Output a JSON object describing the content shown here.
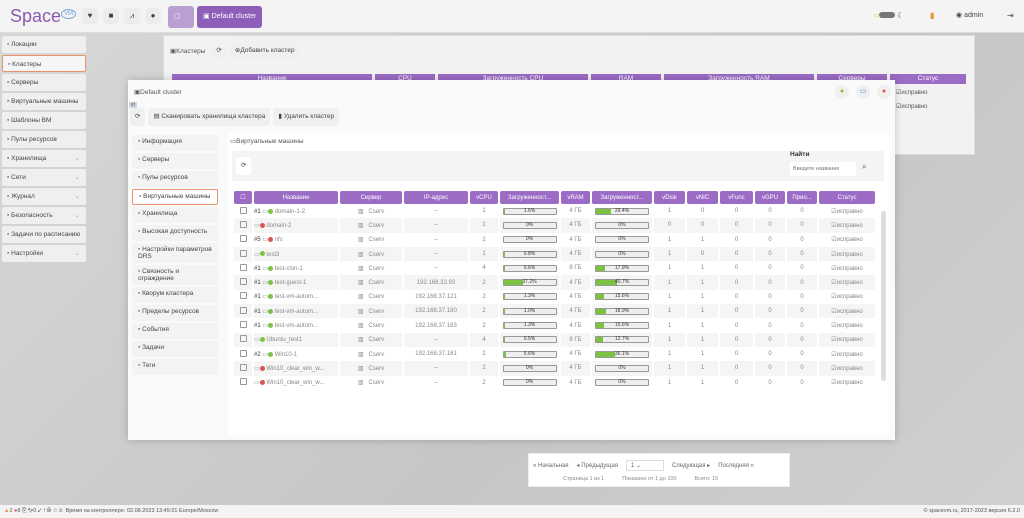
{
  "header": {
    "logo": "Space",
    "logo_badge": "VM",
    "tab_label": "Default cluster",
    "user": "admin",
    "icons": [
      "heart-icon",
      "folder-icon",
      "network-icon",
      "globe-icon"
    ]
  },
  "sidebar": {
    "items": [
      {
        "label": "Локации"
      },
      {
        "label": "Кластеры",
        "active": true
      },
      {
        "label": "Серверы"
      },
      {
        "label": "Виртуальные машины"
      },
      {
        "label": "Шаблоны ВМ"
      },
      {
        "label": "Пулы ресурсов"
      },
      {
        "label": "Хранилища",
        "chevron": true
      },
      {
        "label": "Сети",
        "chevron": true
      },
      {
        "label": "Журнал",
        "chevron": true
      },
      {
        "label": "Безопасность",
        "chevron": true
      },
      {
        "label": "Задачи по расписанию"
      },
      {
        "label": "Настройки",
        "chevron": true
      }
    ]
  },
  "bg_panel": {
    "title": "Кластеры",
    "add_label": "Добавить кластер",
    "columns": [
      "Название",
      "CPU",
      "Загруженность CPU",
      "RAM",
      "Загруженность RAM",
      "Серверы",
      "Статус"
    ],
    "status_values": [
      "исправно",
      "исправно"
    ]
  },
  "modal": {
    "title": "Default cluster",
    "id_badge": "id",
    "scan_label": "Сканировать хранилища кластера",
    "delete_label": "Удалить кластер",
    "nav": [
      {
        "label": "Информация"
      },
      {
        "label": "Серверы"
      },
      {
        "label": "Пулы ресурсов"
      },
      {
        "label": "Виртуальные машины",
        "active": true
      },
      {
        "label": "Хранилища"
      },
      {
        "label": "Высокая доступность"
      },
      {
        "label": "Настройки параметров DRS"
      },
      {
        "label": "Связность и ограждение"
      },
      {
        "label": "Кворум кластера"
      },
      {
        "label": "Пределы ресурсов"
      },
      {
        "label": "События"
      },
      {
        "label": "Задачи"
      },
      {
        "label": "Теги"
      }
    ],
    "section_title": "Виртуальные машины",
    "search_label": "Найти",
    "search_placeholder": "Введите название",
    "columns": [
      "Название",
      "Сервер",
      "IP-адрес",
      "vCPU",
      "Загруженност...",
      "vRAM",
      "Загруженност...",
      "vDisk",
      "vNIC",
      "vFunc",
      "vGPU",
      "Прио...",
      "Статус"
    ],
    "rows": [
      {
        "name": "domain-1-2",
        "tag": "#1",
        "on": true,
        "server": "Cserv",
        "ip": "–",
        "vcpu": "1",
        "cpu": 1.6,
        "cpu_label": "1.6%",
        "vram": "4 ГБ",
        "ram": 29.4,
        "ram_label": "29.4%",
        "vdisk": "1",
        "vnic": "0",
        "vfunc": "0",
        "vgpu": "0",
        "prio": "0",
        "status": "исправно"
      },
      {
        "name": "domain-2",
        "tag": "",
        "on": false,
        "server": "Cserv",
        "ip": "–",
        "vcpu": "1",
        "cpu": 0,
        "cpu_label": "0%",
        "vram": "4 ГБ",
        "ram": 0,
        "ram_label": "0%",
        "vdisk": "0",
        "vnic": "0",
        "vfunc": "0",
        "vgpu": "0",
        "prio": "0",
        "status": "исправно"
      },
      {
        "name": "nfs",
        "tag": "#5",
        "on": false,
        "server": "Cserv",
        "ip": "–",
        "vcpu": "2",
        "cpu": 0,
        "cpu_label": "0%",
        "vram": "4 ГБ",
        "ram": 0,
        "ram_label": "0%",
        "vdisk": "1",
        "vnic": "1",
        "vfunc": "0",
        "vgpu": "0",
        "prio": "0",
        "status": "исправно"
      },
      {
        "name": "test3",
        "tag": "",
        "on": true,
        "server": "Cserv",
        "ip": "–",
        "vcpu": "1",
        "cpu": 0.8,
        "cpu_label": "0.8%",
        "vram": "4 ГБ",
        "ram": 0,
        "ram_label": "0%",
        "vdisk": "1",
        "vnic": "0",
        "vfunc": "0",
        "vgpu": "0",
        "prio": "0",
        "status": "исправно"
      },
      {
        "name": "test-clon-1",
        "tag": "#1",
        "on": true,
        "server": "Cserv",
        "ip": "–",
        "vcpu": "4",
        "cpu": 0.6,
        "cpu_label": "0.6%",
        "vram": "8 ГБ",
        "ram": 17.9,
        "ram_label": "17.9%",
        "vdisk": "1",
        "vnic": "1",
        "vfunc": "0",
        "vgpu": "0",
        "prio": "0",
        "status": "исправно"
      },
      {
        "name": "test-guest-1",
        "tag": "#1",
        "on": true,
        "server": "Cserv",
        "ip": "192.168.33.93",
        "vcpu": "2",
        "cpu": 37.2,
        "cpu_label": "37.2%",
        "vram": "4 ГБ",
        "ram": 40.7,
        "ram_label": "40.7%",
        "vdisk": "1",
        "vnic": "1",
        "vfunc": "0",
        "vgpu": "0",
        "prio": "0",
        "status": "исправно"
      },
      {
        "name": "test-vm-autom...",
        "tag": "#1",
        "on": true,
        "server": "Cserv",
        "ip": "192.168.37.121",
        "vcpu": "2",
        "cpu": 1.3,
        "cpu_label": "1.3%",
        "vram": "4 ГБ",
        "ram": 15.6,
        "ram_label": "15.6%",
        "vdisk": "1",
        "vnic": "1",
        "vfunc": "0",
        "vgpu": "0",
        "prio": "0",
        "status": "исправно"
      },
      {
        "name": "test-vm-autom...",
        "tag": "#1",
        "on": true,
        "server": "Cserv",
        "ip": "192.168.37.180",
        "vcpu": "2",
        "cpu": 1.0,
        "cpu_label": "1.0%",
        "vram": "4 ГБ",
        "ram": 18.9,
        "ram_label": "18.9%",
        "vdisk": "1",
        "vnic": "1",
        "vfunc": "0",
        "vgpu": "0",
        "prio": "0",
        "status": "исправно"
      },
      {
        "name": "test-vm-autom...",
        "tag": "#1",
        "on": true,
        "server": "Cserv",
        "ip": "192.168.37.183",
        "vcpu": "2",
        "cpu": 1.3,
        "cpu_label": "1.3%",
        "vram": "4 ГБ",
        "ram": 15.6,
        "ram_label": "15.6%",
        "vdisk": "1",
        "vnic": "1",
        "vfunc": "0",
        "vgpu": "0",
        "prio": "0",
        "status": "исправно"
      },
      {
        "name": "Ubuntu_test1",
        "tag": "",
        "on": true,
        "server": "Cserv",
        "ip": "–",
        "vcpu": "4",
        "cpu": 0.5,
        "cpu_label": "0.5%",
        "vram": "8 ГБ",
        "ram": 12.7,
        "ram_label": "12.7%",
        "vdisk": "1",
        "vnic": "1",
        "vfunc": "0",
        "vgpu": "0",
        "prio": "0",
        "status": "исправно"
      },
      {
        "name": "Win10-1",
        "tag": "#2",
        "on": true,
        "server": "Cserv",
        "ip": "192.168.37.181",
        "vcpu": "2",
        "cpu": 5.6,
        "cpu_label": "5.6%",
        "vram": "4 ГБ",
        "ram": 36.1,
        "ram_label": "36.1%",
        "vdisk": "1",
        "vnic": "1",
        "vfunc": "0",
        "vgpu": "0",
        "prio": "0",
        "status": "исправно"
      },
      {
        "name": "Win10_clear_win_w...",
        "tag": "",
        "on": false,
        "server": "Cserv",
        "ip": "–",
        "vcpu": "2",
        "cpu": 0,
        "cpu_label": "0%",
        "vram": "4 ГБ",
        "ram": 0,
        "ram_label": "0%",
        "vdisk": "1",
        "vnic": "1",
        "vfunc": "0",
        "vgpu": "0",
        "prio": "0",
        "status": "исправно"
      },
      {
        "name": "Win10_clear_win_w...",
        "tag": "",
        "on": false,
        "server": "Cserv",
        "ip": "–",
        "vcpu": "2",
        "cpu": 0,
        "cpu_label": "0%",
        "vram": "4 ГБ",
        "ram": 0,
        "ram_label": "0%",
        "vdisk": "1",
        "vnic": "1",
        "vfunc": "0",
        "vgpu": "0",
        "prio": "0",
        "status": "исправно"
      }
    ],
    "pager": {
      "first": "Начальная",
      "prev": "Предыдущая",
      "page": "1",
      "next": "Следующая",
      "last": "Последняя",
      "page_info": "Страница 1 из 1",
      "shown": "Показано от 1 до 100",
      "total": "Всего: 15"
    }
  },
  "footer": {
    "warn_count": "2",
    "err_count": "8",
    "tasks_count": "0",
    "controller_time": "Время на контроллере: 02.08.2023 13:45:01 Europe/Moscow",
    "copyright": "© spacevm.ru, 2017-2023 версия 6.2.0"
  },
  "colors": {
    "accent": "#9b6bc6",
    "active_border": "#e8936b",
    "bar_fill": "#7cc242"
  }
}
